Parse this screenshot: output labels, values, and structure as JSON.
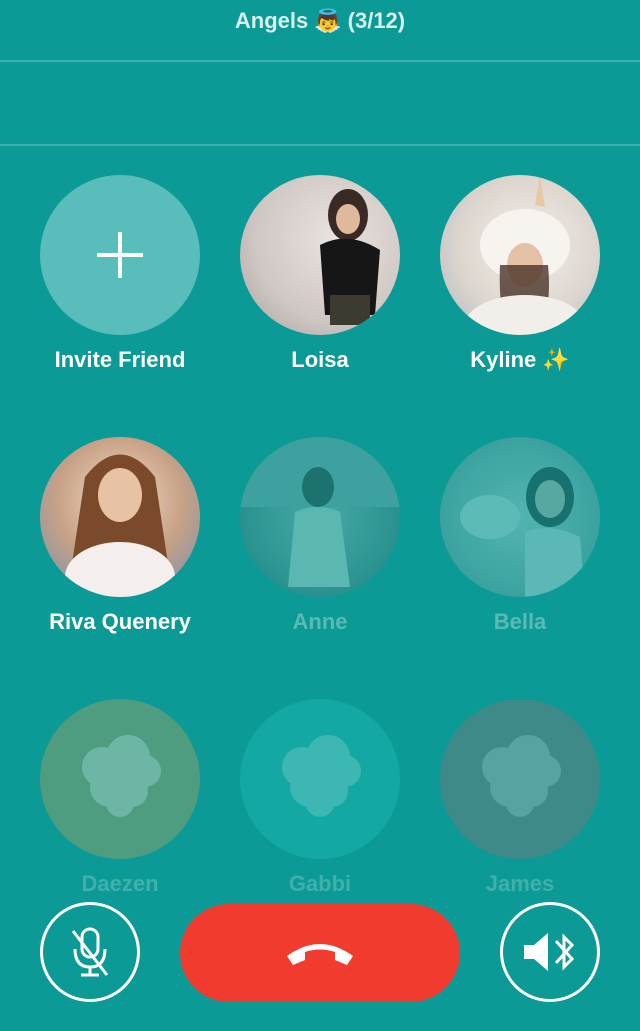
{
  "header": {
    "title": "Angels",
    "emoji": "👼",
    "count": "(3/12)"
  },
  "members": [
    {
      "name": "Invite Friend",
      "state": "invite"
    },
    {
      "name": "Loisa",
      "state": "active"
    },
    {
      "name": "Kyline ✨",
      "state": "active"
    },
    {
      "name": "Riva Quenery",
      "state": "active"
    },
    {
      "name": "Anne",
      "state": "inactive"
    },
    {
      "name": "Bella",
      "state": "inactive"
    },
    {
      "name": "Daezen",
      "state": "inactive"
    },
    {
      "name": "Gabbi",
      "state": "inactive"
    },
    {
      "name": "James",
      "state": "inactive"
    }
  ],
  "controls": {
    "mute_icon": "mic-muted-icon",
    "hangup_icon": "phone-hangup-icon",
    "speaker_icon": "speaker-bluetooth-icon"
  },
  "colors": {
    "background": "#0b9a96",
    "hangup": "#f23b2f"
  }
}
